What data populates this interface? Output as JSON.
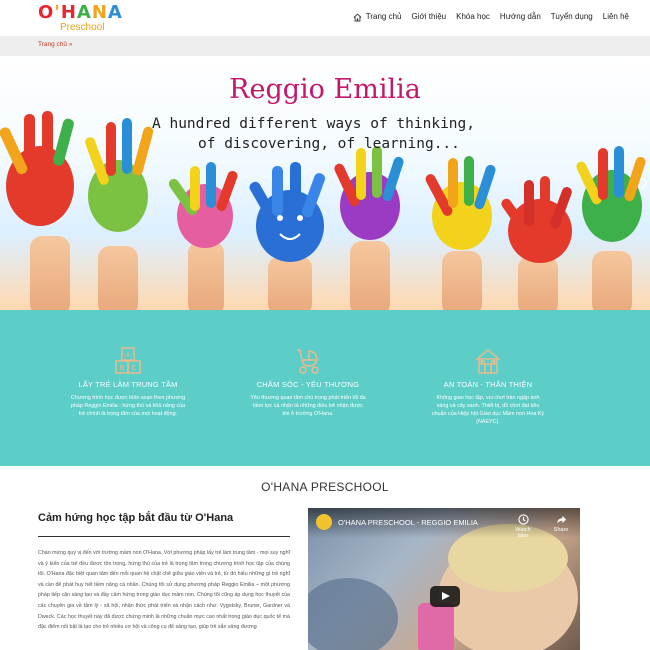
{
  "logo": {
    "letters": [
      "O",
      "'",
      "H",
      "A",
      "N",
      "A"
    ],
    "letter_colors": [
      "#e8262f",
      "#f2a51a",
      "#e8262f",
      "#3eb04a",
      "#f2a51a",
      "#2a8fd6"
    ],
    "subtitle": "Preschool"
  },
  "nav": {
    "items": [
      {
        "label": "Trang chủ",
        "icon": "home-icon"
      },
      {
        "label": "Giới thiệu"
      },
      {
        "label": "Khóa học"
      },
      {
        "label": "Hướng dẫn"
      },
      {
        "label": "Tuyển dụng"
      },
      {
        "label": "Liên hệ"
      }
    ]
  },
  "breadcrumb": {
    "text": "Trang chủ »"
  },
  "banner": {
    "title": "Reggio Emilia",
    "subtitle_line1": "A hundred different ways of thinking,",
    "subtitle_line2": "of discovering, of learning..."
  },
  "features": [
    {
      "icon": "building-blocks-icon",
      "title": "LẤY TRẺ LÀM TRUNG TÂM",
      "description": "Chương trình học được biên soạn theo phương pháp Reggio Emilia - hứng thú và khả năng của trẻ chính là trọng tâm của mọi hoạt động."
    },
    {
      "icon": "stroller-icon",
      "title": "CHĂM SÓC - YÊU THƯƠNG",
      "description": "Yêu thương quan tâm chú trọng phát triển tối đa tiềm lực cá nhân là những điều trẻ nhận được khi ở trường O'Hana."
    },
    {
      "icon": "house-icon",
      "title": "AN TOÀN - THÂN THIỆN",
      "description": "Không gian học tập, vui chơi tràn ngập ánh sáng và cây xanh. Thiết bị, đồ chơi đạt tiêu chuẩn của Hiệp hội Giáo dục Mầm non Hoa Kỳ (NAEYC)."
    }
  ],
  "section_title": "O'HANA PRESCHOOL",
  "intro": {
    "heading": "Cảm hứng học tập bắt đầu từ O'Hana",
    "paragraph": "Chào mừng quý vị đến với trường mầm non O'Hana. Với phương pháp lấy trẻ làm trung tâm - mọi suy nghĩ và ý kiến của trẻ đều được tôn trọng, hứng thú của trẻ là trọng tâm trong chương trình học tập của chúng tôi. O'Hana đặc biệt quan tâm đến mối quan hệ chặt chẽ giữa giáo viên và trẻ, từ đó hiểu những gì trẻ nghĩ và cần để phát huy hết tiềm năng cá nhân. Chúng tôi sử dụng phương pháp Reggio Emilia – một phương pháp tiếp cận sáng tạo và đầy cảm hứng trong giáo dục mầm non. Chúng tôi cũng áp dụng học thuyết của các chuyên gia về tâm lý - xã hội, nhận thức phát triển và nhận cách như: Vygotsky, Bruner, Gardner và Dweck. Các học thuyết này đã được chứng minh là những chuẩn mực cao nhất trong giáo dục quốc tế mà đặc điểm nổi bật là tạo cho trẻ nhiều cơ hội và công cụ để sáng tạo, giúp trẻ sẵn sàng đương"
  },
  "video": {
    "title": "O'HANA PRESCHOOL - REGGIO EMILIA",
    "watch_later": "Watch later",
    "share": "Share"
  }
}
